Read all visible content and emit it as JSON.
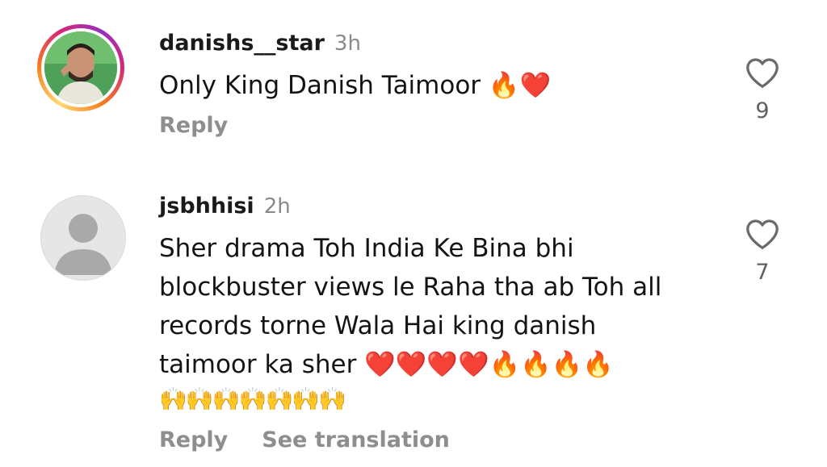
{
  "comments": [
    {
      "username": "danishs__star",
      "time": "3h",
      "text": "Only King Danish Taimoor 🔥❤️",
      "emoji_line": "",
      "actions": [
        "Reply"
      ],
      "likes": "9",
      "avatar": "story-ring-photo"
    },
    {
      "username": "jsbhhisi",
      "time": "2h",
      "text": "Sher drama Toh India Ke Bina bhi blockbuster views le Raha tha ab Toh all records torne Wala Hai king danish taimoor ka sher ❤️❤️❤️❤️🔥🔥🔥🔥",
      "emoji_line": "🙌🙌🙌🙌🙌🙌🙌",
      "actions": [
        "Reply",
        "See translation"
      ],
      "likes": "7",
      "avatar": "default-avatar"
    }
  ],
  "icons": {
    "like": "heart-outline-icon"
  },
  "colors": {
    "text": "#141414",
    "muted": "#8e8e8e",
    "ring_start": "#feda75",
    "ring_end": "#962fbf"
  }
}
